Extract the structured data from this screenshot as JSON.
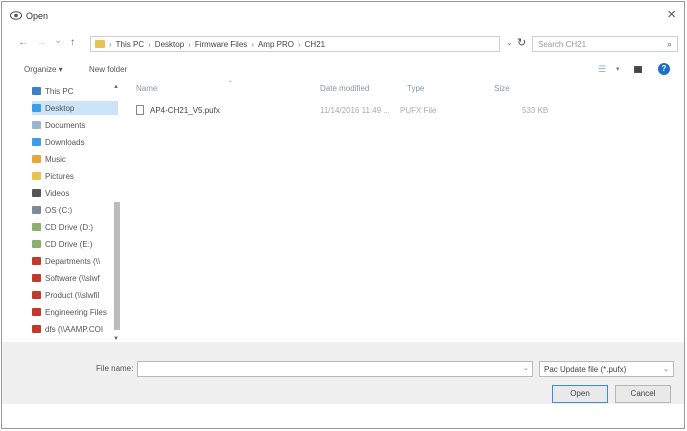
{
  "window": {
    "title": "Open",
    "close": "×"
  },
  "nav": {
    "back": "←",
    "forward": "→",
    "recent": "⌄",
    "up": "↑",
    "breadcrumb": [
      "This PC",
      "Desktop",
      "Firmware Files",
      "Amp PRO",
      "CH21"
    ],
    "separator": "›",
    "refresh": "↻",
    "search_placeholder": "Search CH21",
    "search_icon": "⌕"
  },
  "toolbar": {
    "organize": "Organize ▾",
    "new_folder": "New folder",
    "help": "?"
  },
  "sidebar": {
    "items": [
      {
        "label": "This PC",
        "icon": "computer-icon",
        "color": "#3c7fc4"
      },
      {
        "label": "Desktop",
        "icon": "desktop-icon",
        "color": "#3c9ee6",
        "selected": true
      },
      {
        "label": "Documents",
        "icon": "documents-icon",
        "color": "#9bb7d0"
      },
      {
        "label": "Downloads",
        "icon": "downloads-icon",
        "color": "#3c9ee6"
      },
      {
        "label": "Music",
        "icon": "music-icon",
        "color": "#e2a83a"
      },
      {
        "label": "Pictures",
        "icon": "pictures-icon",
        "color": "#e8c255"
      },
      {
        "label": "Videos",
        "icon": "videos-icon",
        "color": "#555555"
      },
      {
        "label": "OS (C:)",
        "icon": "drive-icon",
        "color": "#7a8a99"
      },
      {
        "label": "CD Drive (D:)",
        "icon": "cd-drive-icon",
        "color": "#8ab070"
      },
      {
        "label": "CD Drive (E:)",
        "icon": "cd-drive-icon",
        "color": "#8ab070"
      },
      {
        "label": "Departments (\\\\",
        "icon": "network-drive-icon",
        "color": "#c0392b"
      },
      {
        "label": "Software (\\\\slwf",
        "icon": "network-drive-icon",
        "color": "#c0392b"
      },
      {
        "label": "Product (\\\\slwfil",
        "icon": "network-drive-icon",
        "color": "#c0392b"
      },
      {
        "label": "Engineering Files",
        "icon": "network-drive-icon",
        "color": "#c0392b"
      },
      {
        "label": "dfs (\\\\AAMP.COI",
        "icon": "network-drive-icon",
        "color": "#c0392b"
      }
    ]
  },
  "filelist": {
    "columns": [
      "Name",
      "Date modified",
      "Type",
      "Size"
    ],
    "files": [
      {
        "name": "AP4-CH21_V5.pufx",
        "date": "11/14/2016 11:49 ...",
        "type": "PUFX File",
        "size": "533 KB"
      }
    ]
  },
  "bottom": {
    "file_name_label": "File name:",
    "file_name_value": "",
    "filter": "Pac Update file (*.pufx)",
    "open": "Open",
    "cancel": "Cancel"
  },
  "colors": {
    "accent": "#1e6fc8",
    "selection": "#cce4f7",
    "folder": "#e8c255"
  }
}
